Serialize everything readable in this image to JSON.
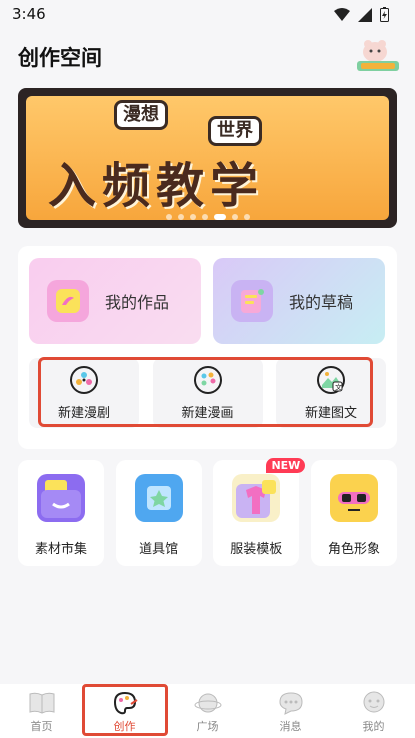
{
  "status_bar": {
    "time": "3:46"
  },
  "header": {
    "title": "创作空间"
  },
  "banner": {
    "tag_left": "漫想",
    "tag_right": "世界",
    "main_text": "入频教学",
    "slide_index": 4,
    "slide_count": 7
  },
  "works": {
    "my_works": "我的作品",
    "my_drafts": "我的草稿"
  },
  "create": [
    {
      "label": "新建漫剧",
      "icon": "film-reel-icon"
    },
    {
      "label": "新建漫画",
      "icon": "palette-icon"
    },
    {
      "label": "新建图文",
      "icon": "image-text-icon"
    }
  ],
  "tools": [
    {
      "label": "素材市集",
      "icon": "material-market-icon",
      "badge": ""
    },
    {
      "label": "道具馆",
      "icon": "props-hall-icon",
      "badge": ""
    },
    {
      "label": "服装模板",
      "icon": "costume-template-icon",
      "badge": "NEW"
    },
    {
      "label": "角色形象",
      "icon": "character-icon",
      "badge": ""
    }
  ],
  "tabs": [
    {
      "label": "首页",
      "icon": "book-icon",
      "active": false
    },
    {
      "label": "创作",
      "icon": "create-palette-icon",
      "active": true
    },
    {
      "label": "广场",
      "icon": "planet-icon",
      "active": false
    },
    {
      "label": "消息",
      "icon": "chat-bubble-icon",
      "active": false
    },
    {
      "label": "我的",
      "icon": "profile-face-icon",
      "active": false
    }
  ],
  "colors": {
    "accent": "#e04a35",
    "badge": "#ff3b55",
    "background": "#f6f6f8"
  }
}
